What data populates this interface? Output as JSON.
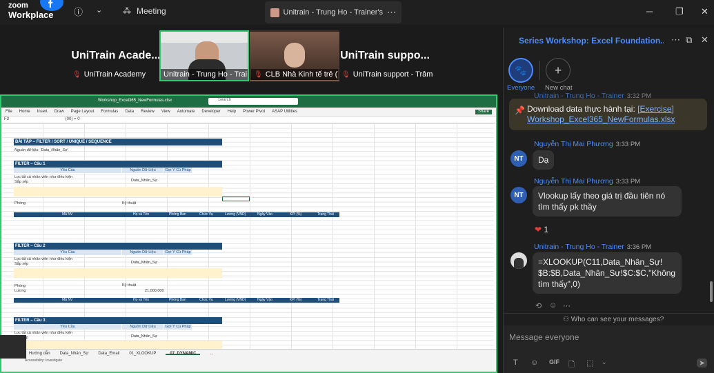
{
  "app": {
    "logo_zoom": "zoom",
    "logo_workplace": "Workplace",
    "meeting_label": "Meeting",
    "share_tab_title": "Unitrain - Trung Ho - Trainer's scre"
  },
  "videos": [
    {
      "big": "UniTrain Acade...",
      "name": "UniTrain Academy"
    },
    {
      "name": "Unitrain - Trung Ho - Trai..."
    },
    {
      "name": "CLB Nhà Kinh tế trẻ (Y..."
    },
    {
      "big": "UniTrain suppo...",
      "name": "UniTrain support - Trâm"
    }
  ],
  "excel": {
    "filename": "Workshop_Excel365_NewFormulas.xlsx",
    "search": "Search",
    "ribbon": [
      "File",
      "Home",
      "Insert",
      "Draw",
      "Page Layout",
      "Formulas",
      "Data",
      "Review",
      "View",
      "Automate",
      "Developer",
      "Help",
      "Power Pivot",
      "ASAP Utilities"
    ],
    "cellref": "F3",
    "formula": "(00) = 0",
    "title": "BÀI TẬP – FILTER / SORT / UNIQUE / SEQUENCE",
    "source_note": "Nguồn dữ liệu: 'Data_Nhân_Sự'",
    "sections": [
      {
        "head": "FILTER – Câu 1",
        "cols": [
          "Yêu Cầu",
          "Nguồn Dữ Liệu",
          "Gợi Ý Cú Pháp"
        ],
        "req1": "Lọc tất cả nhân viên như điều kiện",
        "req2": "Sắp xếp",
        "src": "Data_Nhân_Sự",
        "f1": "Phòng",
        "f2": "Kỹ thuật"
      },
      {
        "head": "FILTER – Câu 2",
        "cols": [
          "Yêu Cầu",
          "Nguồn Dữ Liệu",
          "Gợi Ý Cú Pháp"
        ],
        "req1": "Lọc tất cả nhân viên như điều kiện",
        "req2": "Sắp xếp",
        "src": "Data_Nhân_Sự",
        "f1": "Phòng",
        "f2": "Kỹ thuật",
        "f3": "Lương",
        "f4": "21,000,000"
      },
      {
        "head": "FILTER – Câu 3",
        "cols": [
          "Yêu Cầu",
          "Nguồn Dữ Liệu",
          "Gợi Ý Cú Pháp"
        ],
        "req1": "Lọc tất cả nhân viên như điều kiện",
        "req2": "Sắp xếp",
        "src": "Data_Nhân_Sự"
      }
    ],
    "table_cols": [
      "Mã NV",
      "Họ và Tên",
      "Phòng Ban",
      "Chức Vụ",
      "Lương (VND)",
      "Ngày Vào",
      "KPI (%)",
      "Trạng Thái"
    ],
    "sheets": [
      "Hướng dẫn",
      "Data_Nhân_Sự",
      "Data_Email",
      "01_XLOOKUP",
      "07_DYNAMIC",
      "..."
    ],
    "status": "Accessibility: Investigate",
    "share_btn": "Share"
  },
  "chat": {
    "title": "Series Workshop: Excel Foundation...",
    "everyone": "Everyone",
    "new_chat": "New chat",
    "partial_sender": "Unitrain - Trung Ho - Trainer",
    "partial_time": "3:32 PM",
    "pin_text": "Download data thực hành tại: ",
    "pin_link": "[Exercise] Workshop_Excel365_NewFormulas.xlsx",
    "messages": [
      {
        "sender": "Nguyễn Thị Mai Phương",
        "time": "3:33 PM",
        "initials": "NT",
        "text": "Dạ"
      },
      {
        "sender": "Nguyễn Thị Mai Phương",
        "time": "3:33 PM",
        "initials": "NT",
        "text": "Vlookup lấy theo giá trị đầu tiên nó tìm thấy pk thầy"
      },
      {
        "sender": "Unitrain - Trung Ho - Trainer",
        "time": "3:36 PM",
        "text": "=XLOOKUP(C11,Data_Nhân_Sự!$B:$B,Data_Nhân_Sự!$C:$C,\"Không tìm thấy\",0)"
      }
    ],
    "reaction_count": "1",
    "who_can_see": "Who can see your messages?",
    "input_placeholder": "Message everyone",
    "gif": "GIF"
  },
  "colors": {
    "zoom_blue": "#4a8cff",
    "excel_green": "#1f6e43",
    "header_navy": "#1f4e79",
    "active_border": "#2ecc71"
  }
}
